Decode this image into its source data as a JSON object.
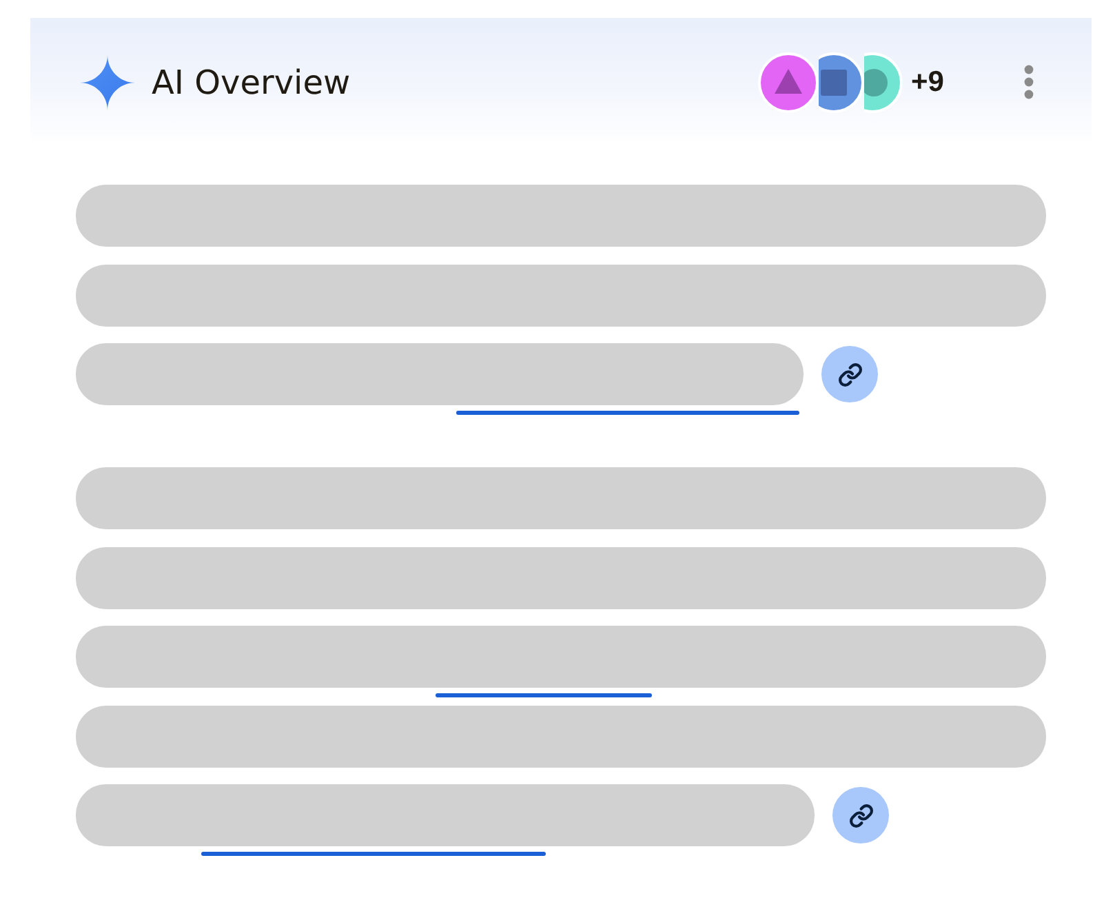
{
  "header": {
    "title": "AI Overview",
    "sources": [
      {
        "kind": "triangle",
        "color": "#e365f5"
      },
      {
        "kind": "square",
        "color": "#6192e0"
      },
      {
        "kind": "circle",
        "color": "#72e5d2"
      }
    ],
    "more_sources": "+9"
  },
  "paragraphs": [
    {
      "lines": [
        {
          "highlighted": false
        },
        {
          "highlighted": false
        },
        {
          "highlighted": true
        }
      ],
      "link": true
    },
    {
      "lines": [
        {
          "highlighted": false
        },
        {
          "highlighted": false
        },
        {
          "highlighted": true
        },
        {
          "highlighted": false
        },
        {
          "highlighted": true
        }
      ],
      "link": true
    }
  ]
}
